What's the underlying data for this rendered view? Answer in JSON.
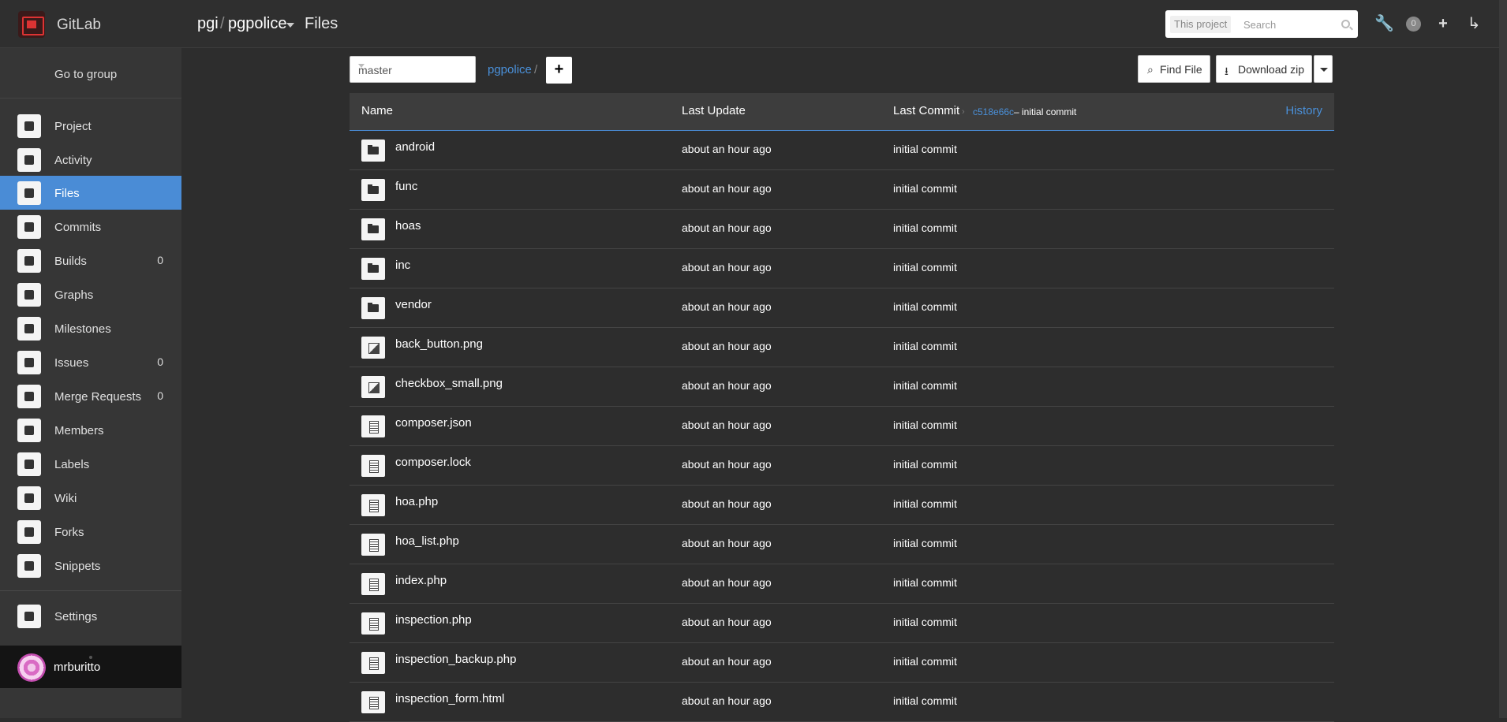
{
  "header": {
    "brand": "GitLab",
    "breadcrumb": {
      "group": "pgi",
      "separator": "/",
      "project": "pgpolice",
      "section": "Files"
    },
    "search": {
      "scope": "This project",
      "placeholder": "Search"
    },
    "notifications_count": "0"
  },
  "sidebar": {
    "go_to_group": "Go to group",
    "items": [
      {
        "label": "Project",
        "icon": "bookmark-icon",
        "count": ""
      },
      {
        "label": "Activity",
        "icon": "dashboard-icon",
        "count": ""
      },
      {
        "label": "Files",
        "icon": "files-icon",
        "count": "",
        "active": true
      },
      {
        "label": "Commits",
        "icon": "history-icon",
        "count": ""
      },
      {
        "label": "Builds",
        "icon": "cubes-icon",
        "count": "0"
      },
      {
        "label": "Graphs",
        "icon": "area-chart-icon",
        "count": ""
      },
      {
        "label": "Milestones",
        "icon": "clock-icon",
        "count": ""
      },
      {
        "label": "Issues",
        "icon": "exclamation-circle-icon",
        "count": "0"
      },
      {
        "label": "Merge Requests",
        "icon": "list-icon",
        "count": "0"
      },
      {
        "label": "Members",
        "icon": "users-icon",
        "count": ""
      },
      {
        "label": "Labels",
        "icon": "tags-icon",
        "count": ""
      },
      {
        "label": "Wiki",
        "icon": "book-icon",
        "count": ""
      },
      {
        "label": "Forks",
        "icon": "code-fork-icon",
        "count": ""
      },
      {
        "label": "Snippets",
        "icon": "clipboard-icon",
        "count": ""
      }
    ],
    "settings": "Settings",
    "user": {
      "name": "mrburitto"
    }
  },
  "toolbar": {
    "branch": "master",
    "path": "pgpolice",
    "path_separator": "/",
    "add": "+",
    "find_file": "Find File",
    "download_zip": "Download zip"
  },
  "table": {
    "headers": {
      "name": "Name",
      "last_update": "Last Update",
      "last_commit": "Last Commit",
      "history": "History"
    },
    "last_commit": {
      "sha": "c518e66c",
      "message": "– initial commit"
    },
    "rows": [
      {
        "name": "android",
        "type": "folder",
        "updated": "about an hour ago",
        "commit": "initial commit"
      },
      {
        "name": "func",
        "type": "folder",
        "updated": "about an hour ago",
        "commit": "initial commit"
      },
      {
        "name": "hoas",
        "type": "folder",
        "updated": "about an hour ago",
        "commit": "initial commit"
      },
      {
        "name": "inc",
        "type": "folder",
        "updated": "about an hour ago",
        "commit": "initial commit"
      },
      {
        "name": "vendor",
        "type": "folder",
        "updated": "about an hour ago",
        "commit": "initial commit"
      },
      {
        "name": "back_button.png",
        "type": "image",
        "updated": "about an hour ago",
        "commit": "initial commit"
      },
      {
        "name": "checkbox_small.png",
        "type": "image",
        "updated": "about an hour ago",
        "commit": "initial commit"
      },
      {
        "name": "composer.json",
        "type": "file",
        "updated": "about an hour ago",
        "commit": "initial commit"
      },
      {
        "name": "composer.lock",
        "type": "file",
        "updated": "about an hour ago",
        "commit": "initial commit"
      },
      {
        "name": "hoa.php",
        "type": "file",
        "updated": "about an hour ago",
        "commit": "initial commit"
      },
      {
        "name": "hoa_list.php",
        "type": "file",
        "updated": "about an hour ago",
        "commit": "initial commit"
      },
      {
        "name": "index.php",
        "type": "file",
        "updated": "about an hour ago",
        "commit": "initial commit"
      },
      {
        "name": "inspection.php",
        "type": "file",
        "updated": "about an hour ago",
        "commit": "initial commit"
      },
      {
        "name": "inspection_backup.php",
        "type": "file",
        "updated": "about an hour ago",
        "commit": "initial commit"
      },
      {
        "name": "inspection_form.html",
        "type": "file",
        "updated": "about an hour ago",
        "commit": "initial commit"
      }
    ]
  },
  "colors": {
    "accent": "#4a8cd6",
    "link": "#4a90d9",
    "background": "#2d2d2d",
    "sidebar": "#363636"
  }
}
